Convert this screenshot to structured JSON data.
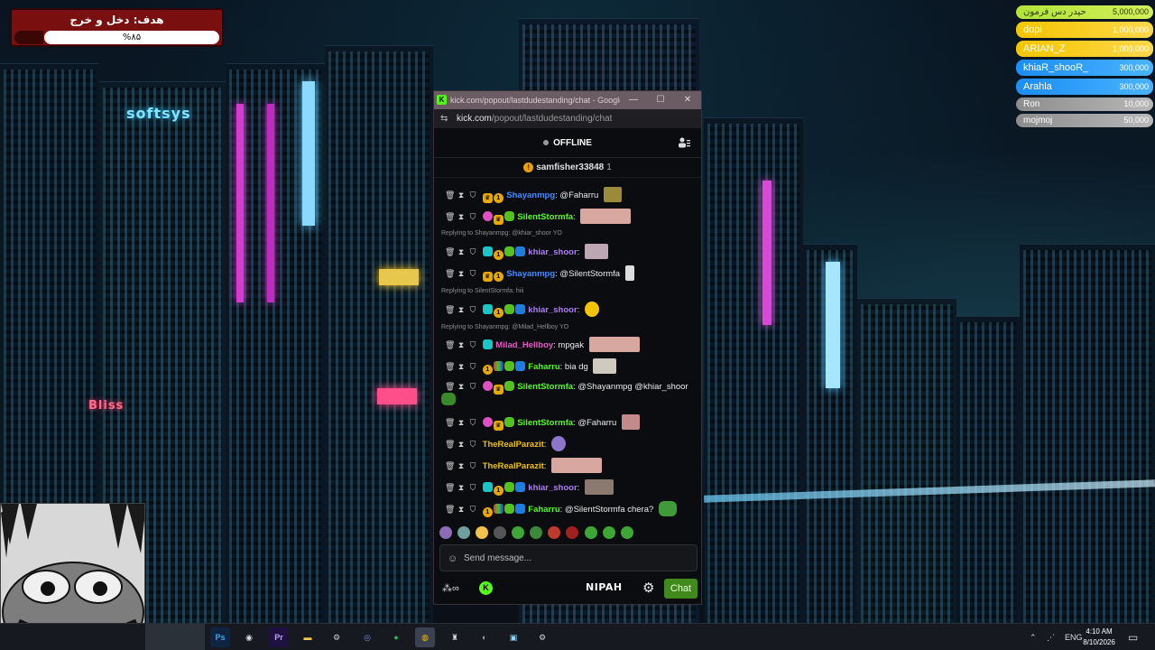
{
  "goal": {
    "title": "هدف: دخل و خرج",
    "progress_label": "%۸۵",
    "progress": 0.85
  },
  "leaderboard": [
    {
      "name": "حیدر دس فرمون",
      "amount": "5,000,000",
      "style": "lime"
    },
    {
      "name": "dopi",
      "amount": "1,000,000",
      "style": "gold"
    },
    {
      "name": "ARIAN_Z",
      "amount": "1,000,000",
      "style": "gold"
    },
    {
      "name": "khiaR_shooR_",
      "amount": "300,000",
      "style": "blue"
    },
    {
      "name": "Arahla",
      "amount": "300,000",
      "style": "blue"
    },
    {
      "name": "Ron",
      "amount": "10,000",
      "style": "grey"
    },
    {
      "name": "mojmoj",
      "amount": "50,000",
      "style": "grey"
    }
  ],
  "browser": {
    "window_title": "kick.com/popout/lastdudestanding/chat - Google C...",
    "url_host": "kick.com",
    "url_path": "/popout/lastdudestanding/chat",
    "window_buttons": [
      "—",
      "☐",
      "✕"
    ]
  },
  "chat": {
    "status": "OFFLINE",
    "pinned_user": "samfisher33848",
    "pinned_count": "1",
    "replies": [
      "Replying to Shayanmpg: @khiar_shoor YO",
      "Replying to SilentStormfa: hiii",
      "Replying to Shayanmpg: @Milad_Hellboy YO"
    ],
    "messages": [
      {
        "user": "Shayanmpg",
        "color": "#3f8cff",
        "text": ": @Faharru"
      },
      {
        "user": "SilentStormfa",
        "color": "#53fc18",
        "text": ":"
      },
      {
        "user": "khiar_shoor",
        "color": "#b07cff",
        "text": ":"
      },
      {
        "user": "Shayanmpg",
        "color": "#3f8cff",
        "text": ": @SilentStormfa"
      },
      {
        "user": "khiar_shoor",
        "color": "#b07cff",
        "text": ":"
      },
      {
        "user": "Milad_Hellboy",
        "color": "#e85ac8",
        "text": ": mpgak"
      },
      {
        "user": "Faharru",
        "color": "#53fc18",
        "text": ": bia dg"
      },
      {
        "user": "SilentStormfa",
        "color": "#53fc18",
        "text": ": @Shayanmpg @khiar_shoor"
      },
      {
        "user": "SilentStormfa",
        "color": "#53fc18",
        "text": ": @Faharru"
      },
      {
        "user": "TheRealParazit",
        "color": "#f0c400",
        "text": ":"
      },
      {
        "user": "TheRealParazit",
        "color": "#f0c400",
        "text": ":"
      },
      {
        "user": "khiar_shoor",
        "color": "#b07cff",
        "text": ":"
      },
      {
        "user": "Faharru",
        "color": "#53fc18",
        "text": ": @SilentStormfa chera?"
      }
    ],
    "input_placeholder": "Send message...",
    "nipah_label": "NIPAH",
    "chat_button": "Chat"
  },
  "taskbar": {
    "apps": [
      "Ps",
      "Pr",
      "Steam",
      "Discord",
      "Spotify",
      "Chrome",
      "Explorer"
    ],
    "language": "ENG",
    "time": "4:10 AM",
    "date": "8/10/2026"
  },
  "colors": {
    "kick_green": "#53fc18",
    "goal_red": "#7a0f10"
  }
}
